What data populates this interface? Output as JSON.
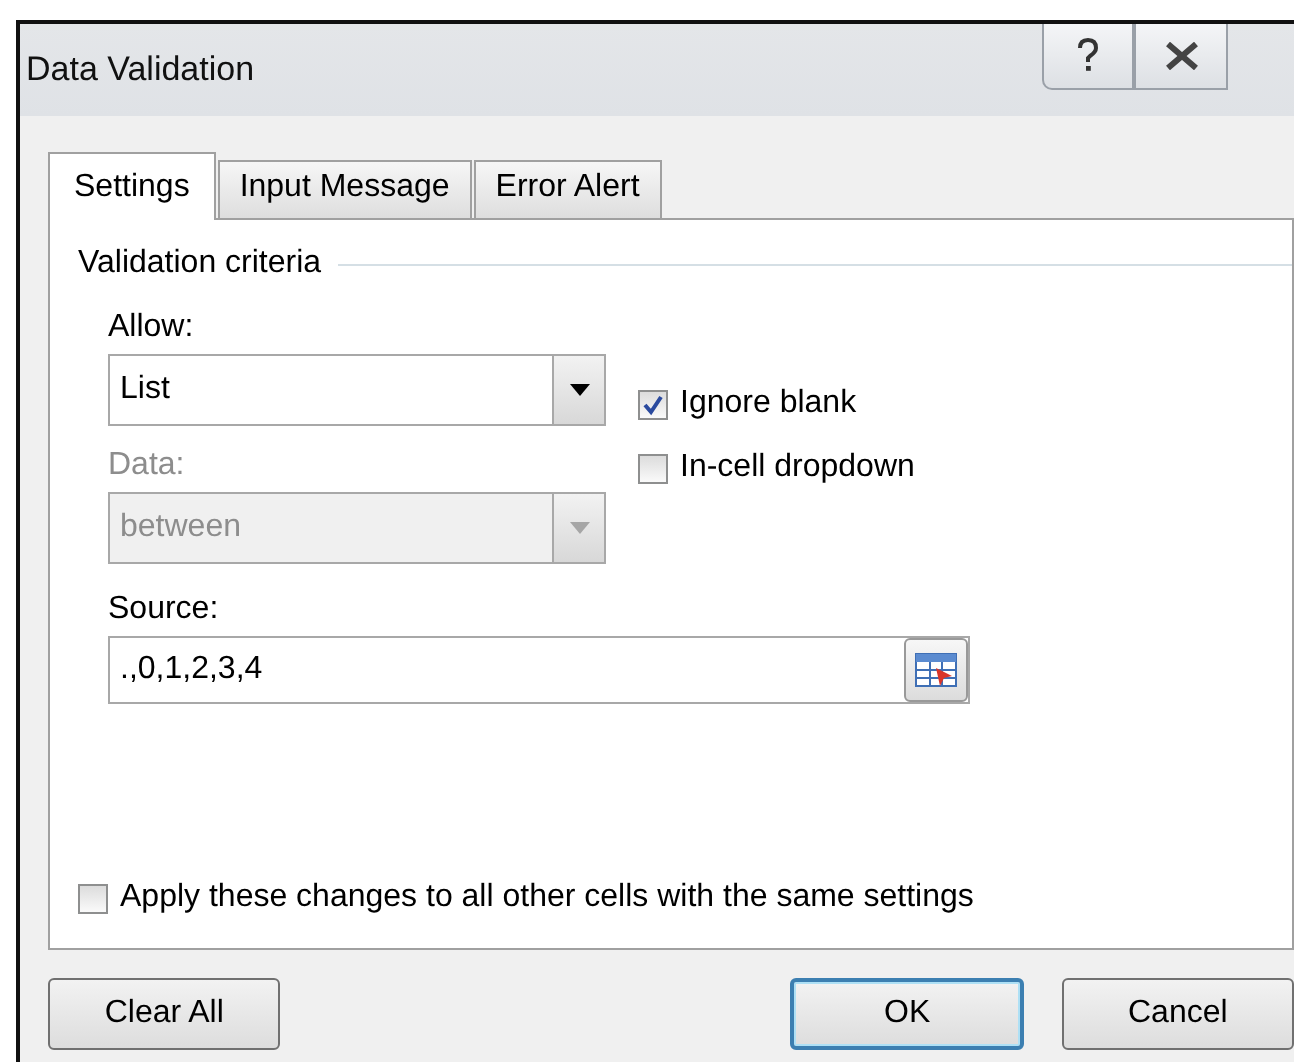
{
  "window": {
    "title": "Data Validation"
  },
  "tabs": [
    {
      "label": "Settings",
      "selected": true
    },
    {
      "label": "Input Message",
      "selected": false
    },
    {
      "label": "Error Alert",
      "selected": false
    }
  ],
  "group_title": "Validation criteria",
  "allow": {
    "label": "Allow:",
    "value": "List",
    "disabled": false
  },
  "data": {
    "label": "Data:",
    "value": "between",
    "disabled": true
  },
  "options": [
    {
      "label": "Ignore blank",
      "checked": true
    },
    {
      "label": "In-cell dropdown",
      "checked": false
    }
  ],
  "source": {
    "label": "Source:",
    "value": ".,0,1,2,3,4"
  },
  "apply": {
    "label": "Apply these changes to all other cells with the same settings",
    "checked": false
  },
  "buttons": [
    {
      "label": "Clear All",
      "default": false,
      "kind": "left"
    },
    {
      "label": "OK",
      "default": true,
      "kind": "right"
    },
    {
      "label": "Cancel",
      "default": false,
      "kind": "right"
    }
  ]
}
